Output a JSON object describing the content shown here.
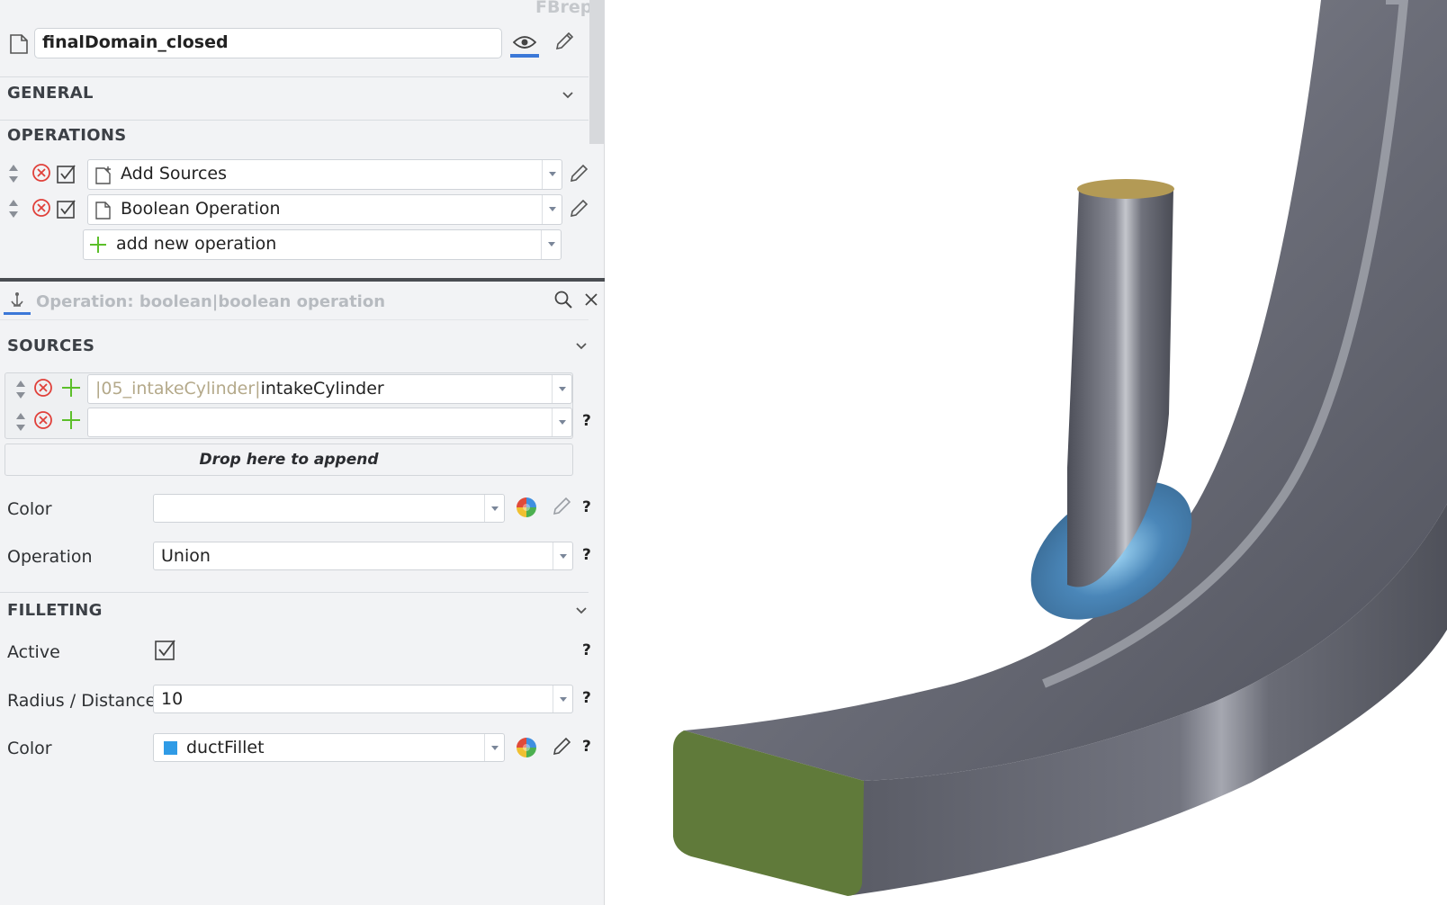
{
  "header": {
    "type_label": "FBrep",
    "name_value": "finalDomain_closed"
  },
  "general": {
    "title": "GENERAL"
  },
  "operations": {
    "title": "OPERATIONS",
    "items": [
      {
        "label": "Add Sources"
      },
      {
        "label": "Boolean Operation"
      }
    ],
    "add_new_label": "add new operation"
  },
  "operation_panel": {
    "title": "Operation: boolean|boolean operation"
  },
  "sources": {
    "title": "SOURCES",
    "rows": [
      {
        "path": "|05_intakeCylinder|",
        "name": "intakeCylinder"
      },
      {
        "path": "",
        "name": ""
      }
    ],
    "drop_label": "Drop here to append"
  },
  "props": {
    "color_label": "Color",
    "color_value": "",
    "operation_label": "Operation",
    "operation_value": "Union"
  },
  "filleting": {
    "title": "FILLETING",
    "active_label": "Active",
    "radius_label": "Radius / Distance",
    "radius_value": "10",
    "color_label": "Color",
    "color_value": "ductFillet",
    "color_swatch": "#2f9be6"
  },
  "help_mark": "?",
  "colors": {
    "accent": "#3b78d8",
    "remove_red": "#e0403a",
    "add_green": "#5cbf2a",
    "duct_body": "#6b6d78",
    "duct_end": "#607a3a",
    "cylinder_top": "#b39a55",
    "fillet": "#4a86b8"
  }
}
